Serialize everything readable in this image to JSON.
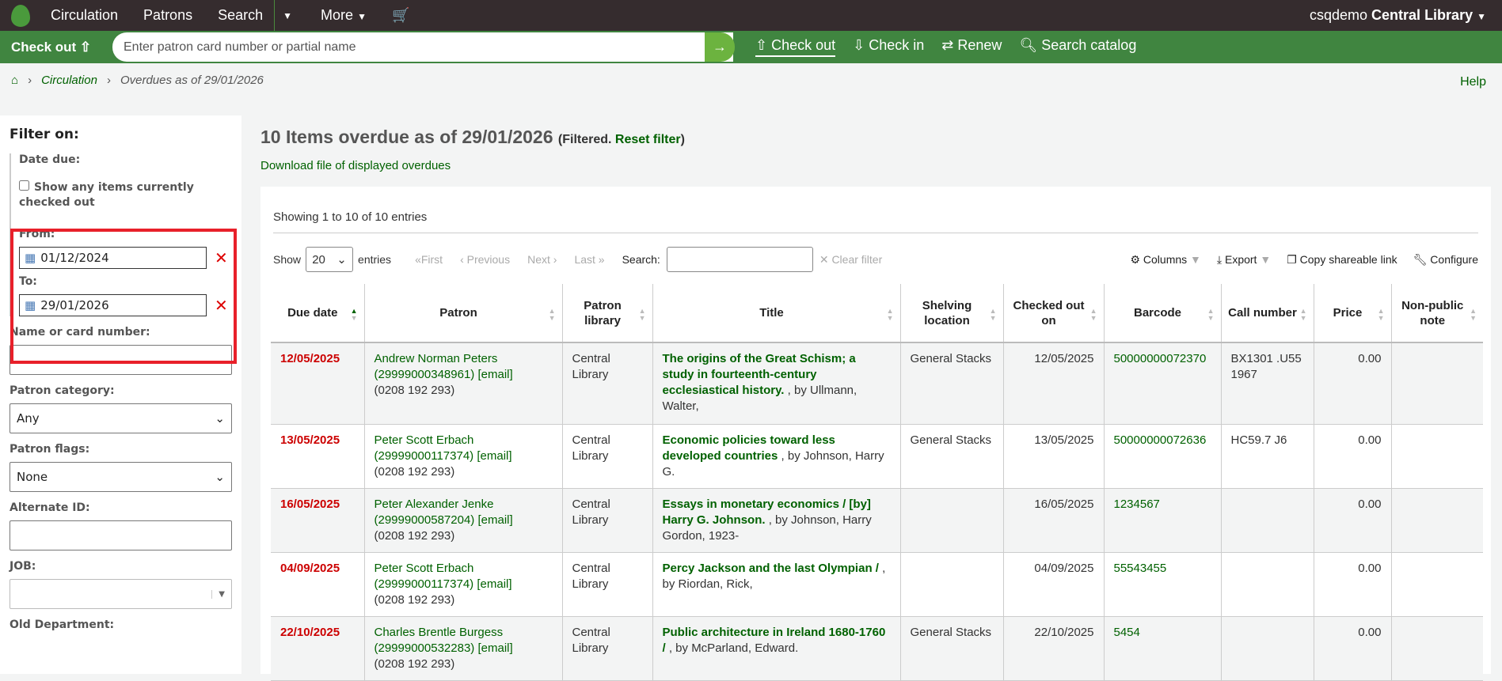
{
  "topbar": {
    "nav": [
      "Circulation",
      "Patrons",
      "Search",
      "More"
    ],
    "user": "csqdemo",
    "library": "Central Library"
  },
  "greenbar": {
    "checkout_label": "Check out",
    "placeholder": "Enter patron card number or partial name",
    "links": [
      "Check out",
      "Check in",
      "Renew",
      "Search catalog"
    ]
  },
  "breadcrumb": {
    "circulation": "Circulation",
    "current": "Overdues as of 29/01/2026"
  },
  "help": "Help",
  "sidebar": {
    "title": "Filter on:",
    "date_due": "Date due:",
    "show_checked_out": "Show any items currently checked out",
    "from_label": "From:",
    "from_value": "01/12/2024",
    "to_label": "To:",
    "to_value": "29/01/2026",
    "name_label": "Name or card number:",
    "category_label": "Patron category:",
    "category_value": "Any",
    "flags_label": "Patron flags:",
    "flags_value": "None",
    "altid_label": "Alternate ID:",
    "job_label": "JOB:",
    "olddept_label": "Old Department:"
  },
  "main": {
    "title": "10 Items overdue as of 29/01/2026",
    "filtered": "(Filtered.",
    "reset": "Reset filter",
    "close_paren": ")",
    "download": "Download file of displayed overdues"
  },
  "table_controls": {
    "showing": "Showing 1 to 10 of 10 entries",
    "show": "Show",
    "page_size": "20",
    "entries": "entries",
    "first": "«First",
    "previous": "‹ Previous",
    "next": "Next ›",
    "last": "Last »",
    "search": "Search:",
    "clear": "✕ Clear filter",
    "columns": "Columns",
    "export": "Export",
    "copy": "Copy shareable link",
    "configure": "Configure"
  },
  "columns": [
    "Due date",
    "Patron",
    "Patron library",
    "Title",
    "Shelving location",
    "Checked out on",
    "Barcode",
    "Call number",
    "Price",
    "Non-public note"
  ],
  "rows": [
    {
      "due": "12/05/2025",
      "patron": "Andrew Norman Peters",
      "card": "(29999000348961)",
      "email": "[email]",
      "phone": "(0208 192 293)",
      "library": "Central Library",
      "title": "The origins of the Great Schism; a study in fourteenth-century ecclesiastical history.",
      "author": ", by Ullmann, Walter,",
      "location": "General Stacks",
      "checked_out": "12/05/2025",
      "barcode": "50000000072370",
      "callnumber": "BX1301 .U55 1967",
      "price": "0.00",
      "note": ""
    },
    {
      "due": "13/05/2025",
      "patron": "Peter Scott Erbach",
      "card": "(29999000117374)",
      "email": "[email]",
      "phone": "(0208 192 293)",
      "library": "Central Library",
      "title": "Economic policies toward less developed countries",
      "author": ", by Johnson, Harry G.",
      "location": "General Stacks",
      "checked_out": "13/05/2025",
      "barcode": "50000000072636",
      "callnumber": "HC59.7 J6",
      "price": "0.00",
      "note": ""
    },
    {
      "due": "16/05/2025",
      "patron": "Peter Alexander Jenke",
      "card": "(29999000587204)",
      "email": "[email]",
      "phone": "(0208 192 293)",
      "library": "Central Library",
      "title": "Essays in monetary economics / [by] Harry G. Johnson.",
      "author": ", by Johnson, Harry Gordon, 1923-",
      "location": "",
      "checked_out": "16/05/2025",
      "barcode": "1234567",
      "callnumber": "",
      "price": "0.00",
      "note": ""
    },
    {
      "due": "04/09/2025",
      "patron": "Peter Scott Erbach",
      "card": "(29999000117374)",
      "email": "[email]",
      "phone": "(0208 192 293)",
      "library": "Central Library",
      "title": "Percy Jackson and the last Olympian /",
      "author": ", by Riordan, Rick,",
      "location": "",
      "checked_out": "04/09/2025",
      "barcode": "55543455",
      "callnumber": "",
      "price": "0.00",
      "note": ""
    },
    {
      "due": "22/10/2025",
      "patron": "Charles Brentle Burgess",
      "card": "(29999000532283)",
      "email": "[email]",
      "phone": "(0208 192 293)",
      "library": "Central Library",
      "title": "Public architecture in Ireland 1680-1760 /",
      "author": ", by McParland, Edward.",
      "location": "General Stacks",
      "checked_out": "22/10/2025",
      "barcode": "5454",
      "callnumber": "",
      "price": "0.00",
      "note": ""
    }
  ]
}
